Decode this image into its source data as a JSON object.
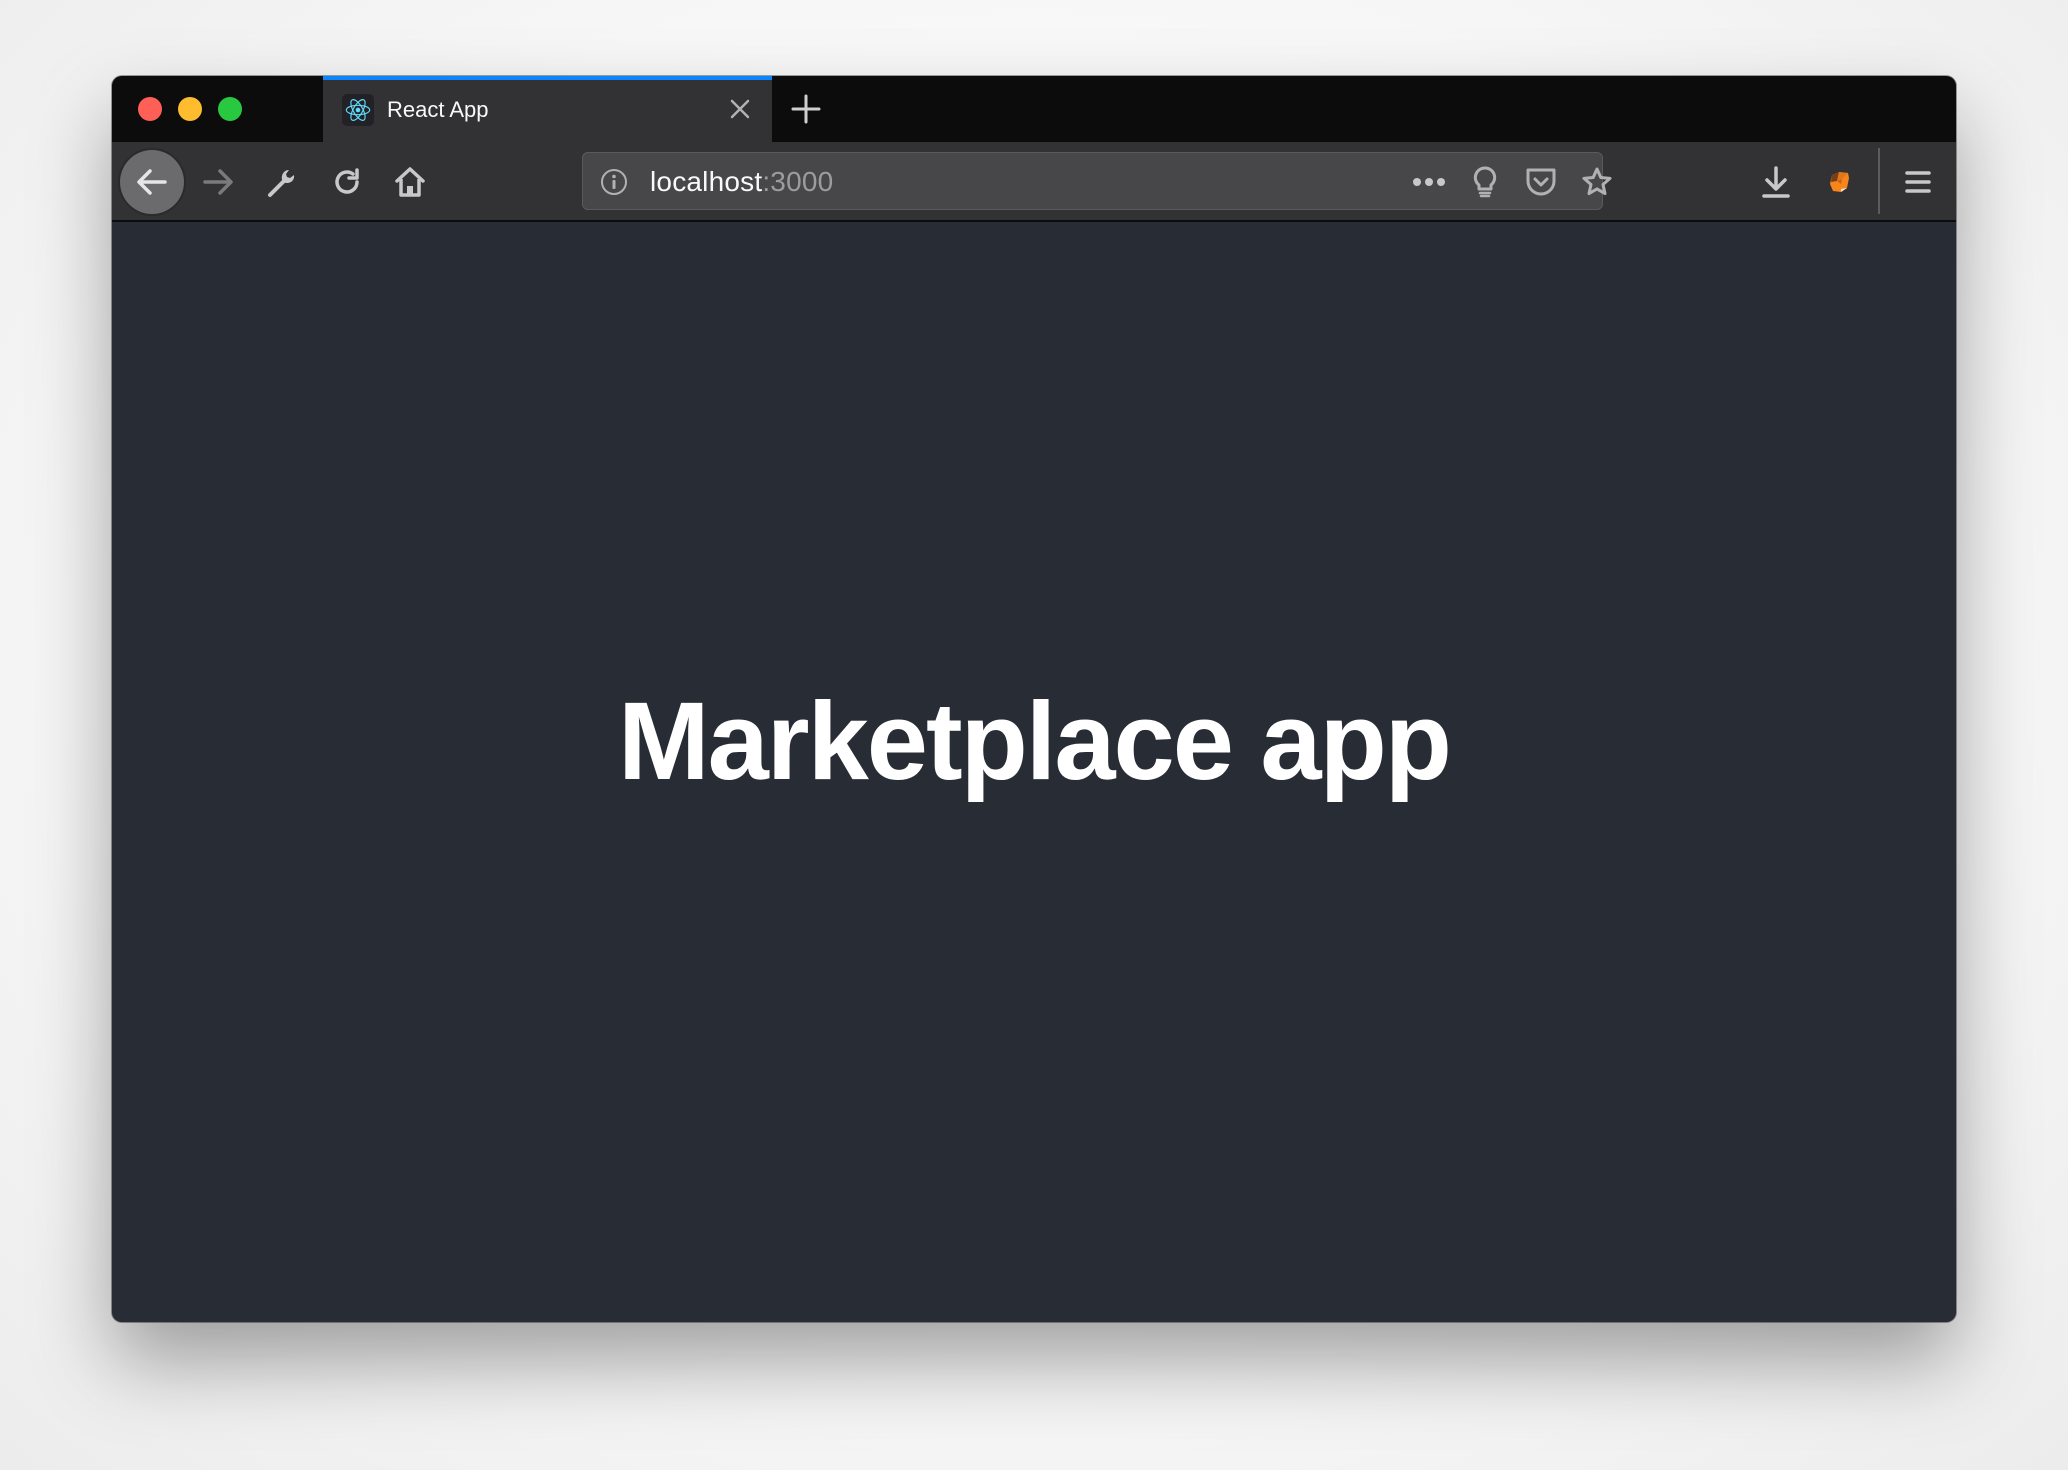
{
  "browser": {
    "tabs": [
      {
        "title": "React App",
        "favicon": "react-logo-icon",
        "active": true
      }
    ],
    "new_tab_icon": "plus-icon",
    "close_tab_icon": "close-icon",
    "toolbar": {
      "back_icon": "arrow-left-icon",
      "forward_icon": "arrow-right-icon",
      "tools_icon": "wrench-icon",
      "reload_icon": "reload-icon",
      "home_icon": "home-icon"
    },
    "urlbar": {
      "info_icon": "info-icon",
      "host": "localhost",
      "port": ":3000",
      "page_actions_icon": "ellipsis-icon",
      "bulb_icon": "lightbulb-icon",
      "pocket_icon": "pocket-icon",
      "bookmark_icon": "star-icon"
    },
    "right_toolbar": {
      "downloads_icon": "download-icon",
      "extension_icon": "metamask-fox-icon",
      "menu_icon": "hamburger-menu-icon"
    },
    "colors": {
      "tab_accent": "#0a84ff",
      "tabbar_bg": "#0c0c0d",
      "toolbar_bg": "#323234",
      "urlbar_bg": "#474749",
      "page_bg": "#282c34"
    }
  },
  "page": {
    "heading": "Marketplace app"
  }
}
